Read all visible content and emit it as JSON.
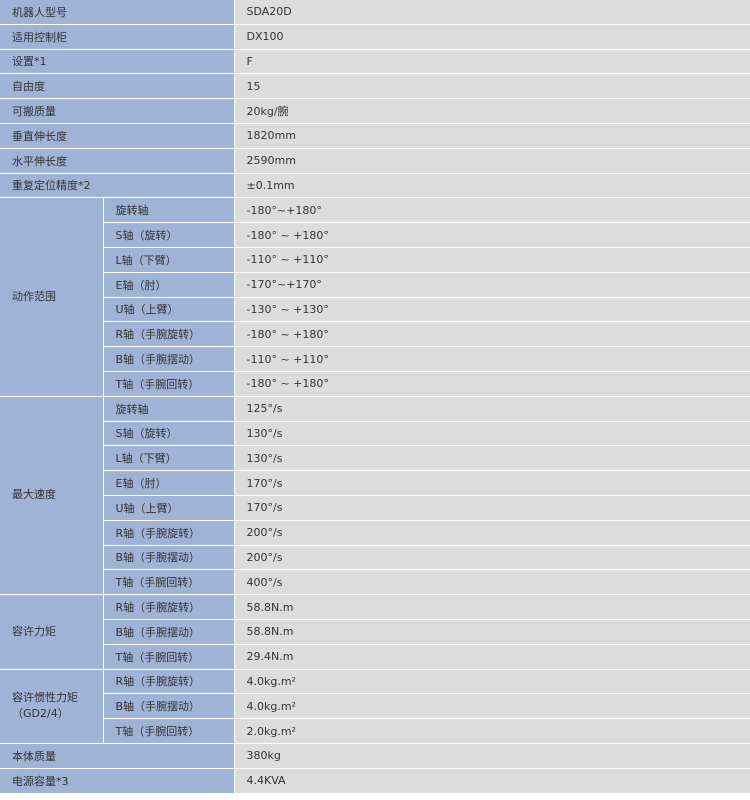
{
  "rows_top": [
    {
      "label": "机器人型号",
      "value": "SDA20D"
    },
    {
      "label": "适用控制柜",
      "value": "DX100"
    },
    {
      "label": "设置*1",
      "value": "F"
    },
    {
      "label": "自由度",
      "value": "15"
    },
    {
      "label": "可搬质量",
      "value": "20kg/腕"
    },
    {
      "label": "垂直伸长度",
      "value": "1820mm"
    },
    {
      "label": "水平伸长度",
      "value": "2590mm"
    },
    {
      "label": "重复定位精度*2",
      "value": "±0.1mm"
    }
  ],
  "groups": [
    {
      "label_lines": [
        "动作范围"
      ],
      "rows": [
        {
          "sub": "旋转轴",
          "value": "-180°~+180°"
        },
        {
          "sub": "S轴（旋转）",
          "value": "-180° ~ +180°"
        },
        {
          "sub": "L轴（下臂）",
          "value": "-110° ~ +110°"
        },
        {
          "sub": "E轴（肘）",
          "value": "-170°~+170°"
        },
        {
          "sub": "U轴（上臂）",
          "value": "-130° ~ +130°"
        },
        {
          "sub": "R轴（手腕旋转）",
          "value": "-180° ~ +180°"
        },
        {
          "sub": "B轴（手腕摆动）",
          "value": "-110° ~ +110°"
        },
        {
          "sub": "T轴（手腕回转）",
          "value": "-180° ~ +180°"
        }
      ]
    },
    {
      "label_lines": [
        "最大速度"
      ],
      "rows": [
        {
          "sub": "旋转轴",
          "value": "125°/s"
        },
        {
          "sub": "S轴（旋转）",
          "value": "130°/s"
        },
        {
          "sub": "L轴（下臂）",
          "value": "130°/s"
        },
        {
          "sub": "E轴（肘）",
          "value": "170°/s"
        },
        {
          "sub": "U轴（上臂）",
          "value": "170°/s"
        },
        {
          "sub": "R轴（手腕旋转）",
          "value": "200°/s"
        },
        {
          "sub": "B轴（手腕摆动）",
          "value": "200°/s"
        },
        {
          "sub": "T轴（手腕回转）",
          "value": "400°/s"
        }
      ]
    },
    {
      "label_lines": [
        "容许力矩"
      ],
      "rows": [
        {
          "sub": "R轴（手腕旋转）",
          "value": "58.8N.m"
        },
        {
          "sub": "B轴（手腕摆动）",
          "value": "58.8N.m"
        },
        {
          "sub": "T轴（手腕回转）",
          "value": "29.4N.m"
        }
      ]
    },
    {
      "label_lines": [
        "容许惯性力矩",
        "（GD2/4）"
      ],
      "rows": [
        {
          "sub": "R轴（手腕旋转）",
          "value": "4.0kg.m²"
        },
        {
          "sub": "B轴（手腕摆动）",
          "value": "4.0kg.m²"
        },
        {
          "sub": "T轴（手腕回转）",
          "value": "2.0kg.m²"
        }
      ]
    }
  ],
  "rows_bottom": [
    {
      "label": "本体质量",
      "value": "380kg"
    },
    {
      "label": "电源容量*3",
      "value": "4.4KVA"
    }
  ]
}
